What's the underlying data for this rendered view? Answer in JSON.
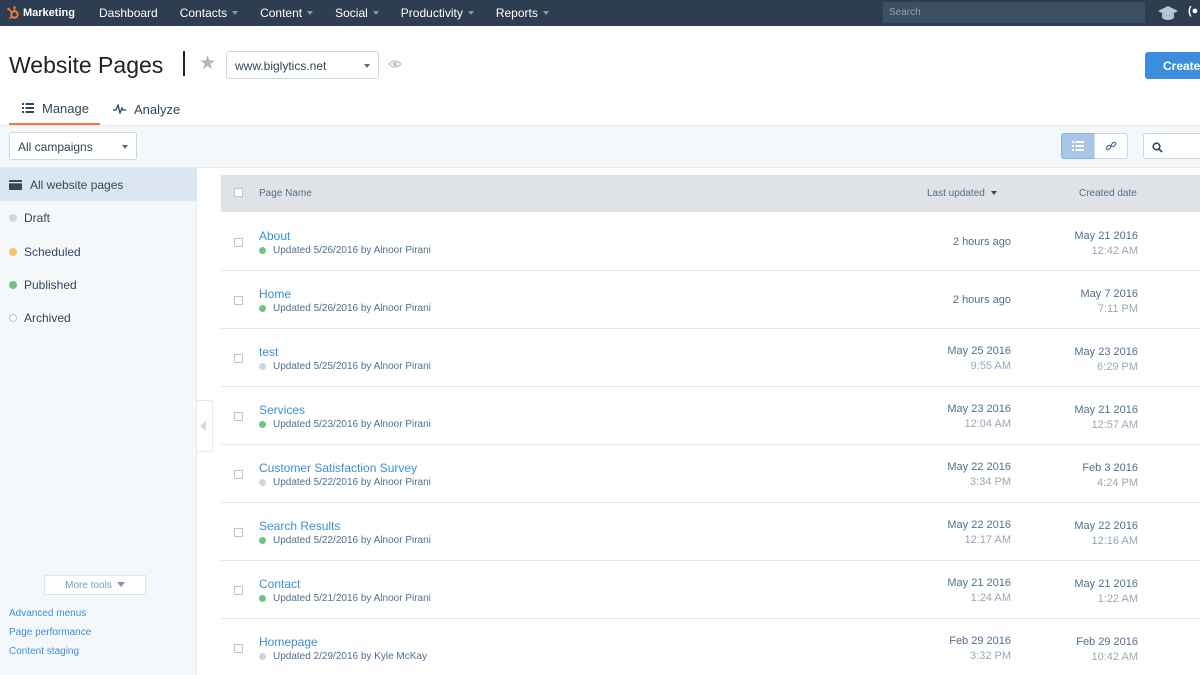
{
  "topnav": {
    "brand": "Marketing",
    "items": [
      {
        "label": "Dashboard",
        "dropdown": false
      },
      {
        "label": "Contacts",
        "dropdown": true
      },
      {
        "label": "Content",
        "dropdown": true
      },
      {
        "label": "Social",
        "dropdown": true
      },
      {
        "label": "Productivity",
        "dropdown": true
      },
      {
        "label": "Reports",
        "dropdown": true
      }
    ],
    "search_placeholder": "Search",
    "brand_color": "#f2773d",
    "bg_color": "#2d3e50"
  },
  "header": {
    "title": "Website Pages",
    "domain": "www.biglytics.net",
    "create_label": "Create"
  },
  "tabs": [
    {
      "label": "Manage",
      "icon": "list-icon",
      "active": true
    },
    {
      "label": "Analyze",
      "icon": "pulse-icon",
      "active": false
    }
  ],
  "filters": {
    "campaign": "All campaigns"
  },
  "sidebar": {
    "items": [
      {
        "label": "All website pages",
        "icon": "folder-icon",
        "active": true
      },
      {
        "label": "Draft",
        "dot_color": "#cbd6e2"
      },
      {
        "label": "Scheduled",
        "dot_color": "#f5c26b"
      },
      {
        "label": "Published",
        "dot_color": "#6fc57e"
      },
      {
        "label": "Archived",
        "dot_color": "hollow"
      }
    ],
    "more_tools": "More tools",
    "links": [
      "Advanced menus",
      "Page performance",
      "Content staging"
    ]
  },
  "table": {
    "columns": {
      "name": "Page Name",
      "updated": "Last updated",
      "created": "Created date"
    },
    "rows": [
      {
        "name": "About",
        "status": "published",
        "meta": "Updated 5/26/2016 by Alnoor Pirani",
        "updated": "2 hours ago",
        "updated_time": "",
        "created": "May 21 2016",
        "created_time": "12:42 AM"
      },
      {
        "name": "Home",
        "status": "published",
        "meta": "Updated 5/26/2016 by Alnoor Pirani",
        "updated": "2 hours ago",
        "updated_time": "",
        "created": "May 7 2016",
        "created_time": "7:11 PM"
      },
      {
        "name": "test",
        "status": "draft",
        "meta": "Updated 5/25/2016 by Alnoor Pirani",
        "updated": "May 25 2016",
        "updated_time": "9:55 AM",
        "created": "May 23 2016",
        "created_time": "6:29 PM"
      },
      {
        "name": "Services",
        "status": "published",
        "meta": "Updated 5/23/2016 by Alnoor Pirani",
        "updated": "May 23 2016",
        "updated_time": "12:04 AM",
        "created": "May 21 2016",
        "created_time": "12:57 AM"
      },
      {
        "name": "Customer Satisfaction Survey",
        "status": "draft",
        "meta": "Updated 5/22/2016 by Alnoor Pirani",
        "updated": "May 22 2016",
        "updated_time": "3:34 PM",
        "created": "Feb 3 2016",
        "created_time": "4:24 PM"
      },
      {
        "name": "Search Results",
        "status": "published",
        "meta": "Updated 5/22/2016 by Alnoor Pirani",
        "updated": "May 22 2016",
        "updated_time": "12:17 AM",
        "created": "May 22 2016",
        "created_time": "12:16 AM"
      },
      {
        "name": "Contact",
        "status": "published",
        "meta": "Updated 5/21/2016 by Alnoor Pirani",
        "updated": "May 21 2016",
        "updated_time": "1:24 AM",
        "created": "May 21 2016",
        "created_time": "1:22 AM"
      },
      {
        "name": "Homepage",
        "status": "draft",
        "meta": "Updated 2/29/2016 by Kyle McKay",
        "updated": "Feb 29 2016",
        "updated_time": "3:32 PM",
        "created": "Feb 29 2016",
        "created_time": "10:42 AM"
      }
    ]
  },
  "colors": {
    "accent": "#3c8dde",
    "link": "#3d8fd6",
    "published": "#6fc57e",
    "draft": "#cbd6e2",
    "scheduled": "#f5c26b"
  }
}
